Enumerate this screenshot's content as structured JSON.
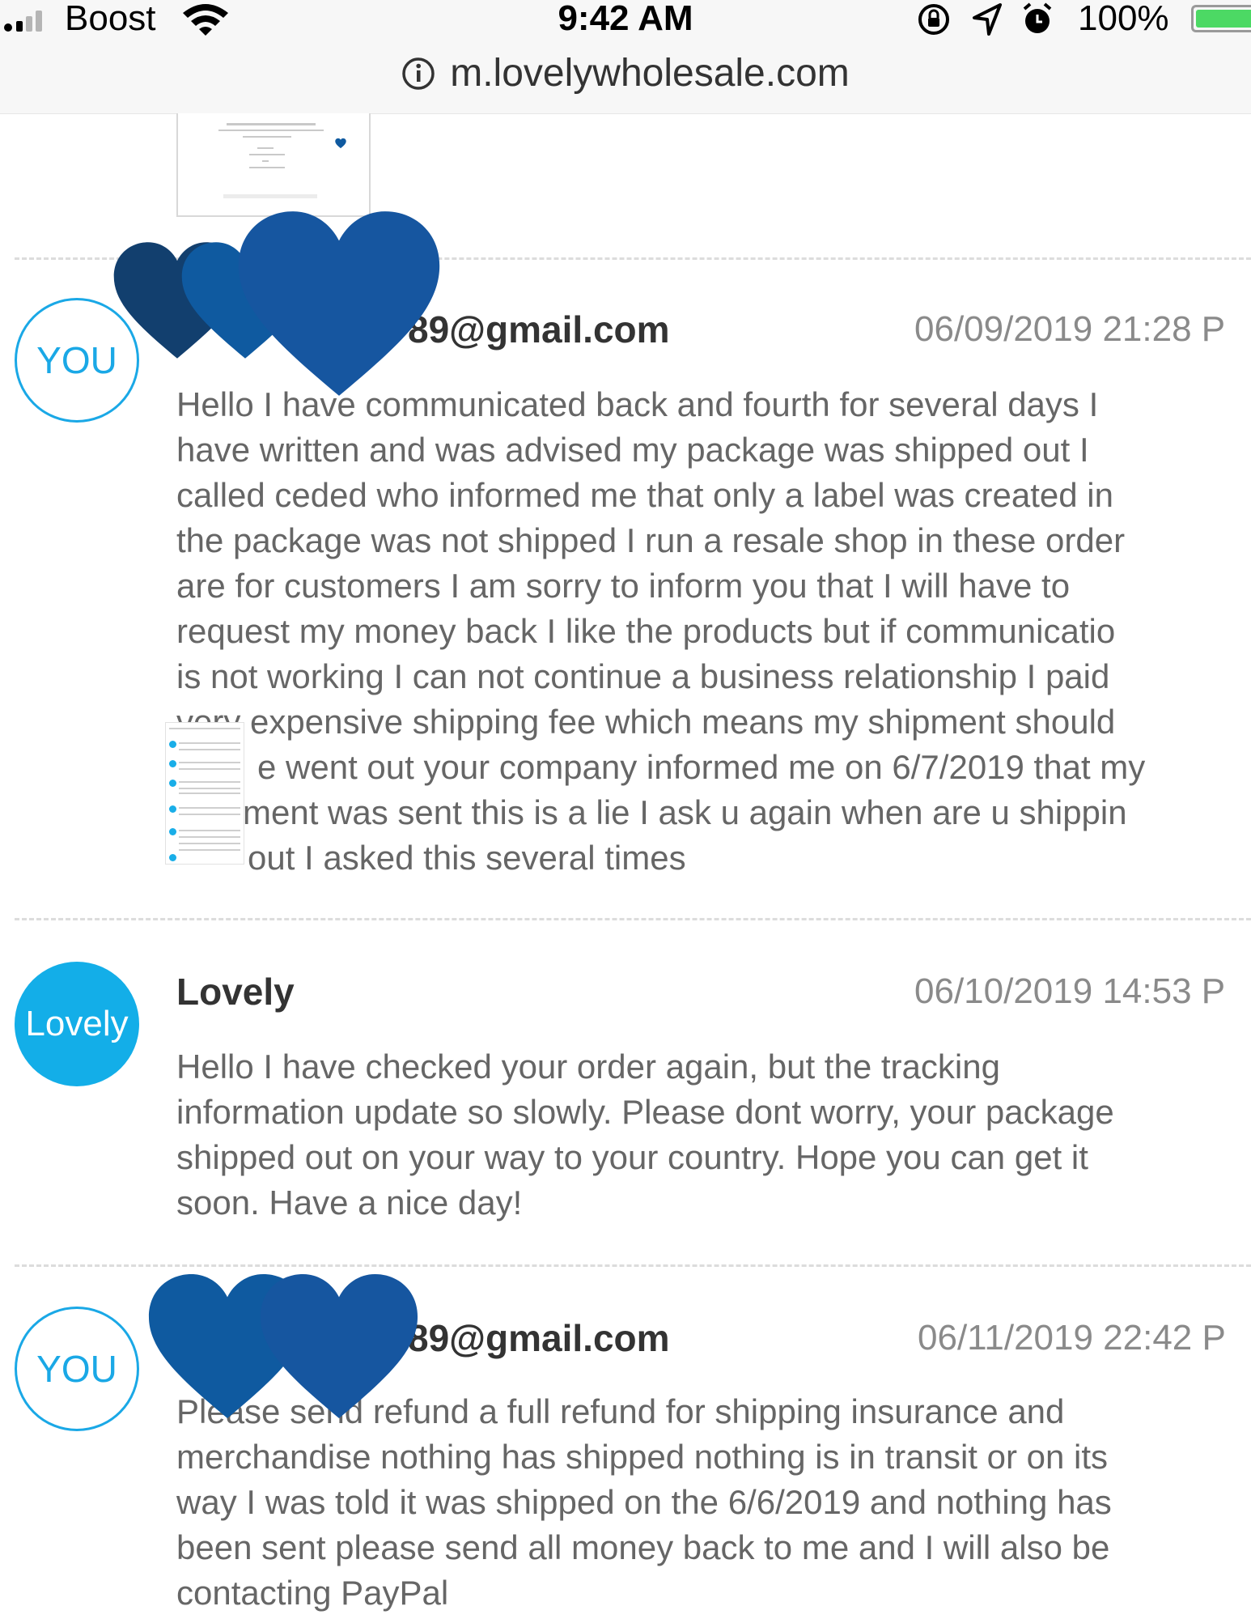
{
  "status_bar": {
    "carrier": "Boost",
    "time": "9:42 AM",
    "battery": "100%",
    "battery_level": 1.0
  },
  "browser": {
    "url": "m.lovelywholesale.com"
  },
  "messages": [
    {
      "avatar": "YOU",
      "sender": "89@gmail.com",
      "timestamp": "06/09/2019 21:28 P",
      "lines": [
        "Hello I have communicated back and fourth for several days I",
        "have written and was advised my package was shipped out I",
        "called ceded who informed me that only a label was created in",
        "the package was not shipped I run a resale shop in these order",
        "are for customers I am sorry to inform you that I will have to",
        "request my money back I like the products but if communicatio",
        "is not working I can not continue a business relationship I paid",
        "very expensive shipping fee which means my shipment should",
        "e went out your company informed me on 6/7/2019 that my",
        "ment was sent this is a lie I ask u again when are u shippin",
        "out I asked this several times"
      ]
    },
    {
      "avatar": "Lovely",
      "sender": "Lovely",
      "timestamp": "06/10/2019 14:53 P",
      "lines": [
        "Hello I have checked your order again, but the tracking",
        "information update so slowly. Please dont worry, your package",
        "shipped out on your way to your country. Hope you can get it",
        "soon. Have a nice day!"
      ]
    },
    {
      "avatar": "YOU",
      "sender": "89@gmail.com",
      "timestamp": "06/11/2019 22:42 P",
      "lines": [
        "Please send refund a full refund for shipping insurance and",
        "merchandise nothing has shipped nothing is in transit or on its",
        "way I was told it was shipped on the 6/6/2019 and nothing has",
        "been sent please send all money back to me and I will also be",
        "contacting PayPal"
      ]
    }
  ],
  "colors": {
    "accent": "#1aa8e6",
    "heart_dark": "#123f6e",
    "heart_mid": "#0f5aa0",
    "heart_light": "#1656a0"
  }
}
